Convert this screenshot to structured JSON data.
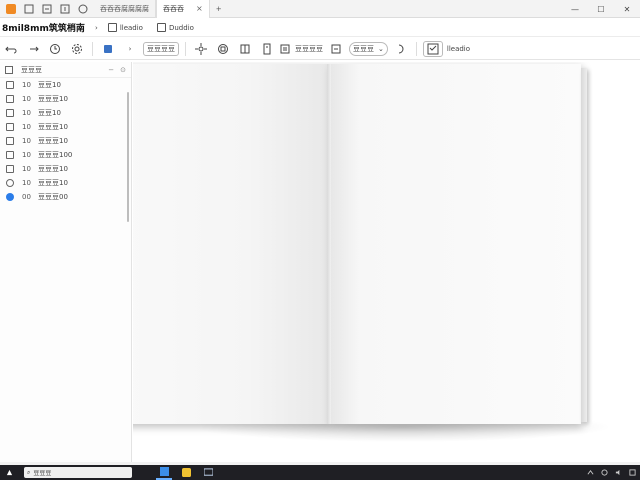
{
  "tabs": [
    {
      "label": "吞吞吞腐腐腐腐",
      "active": false
    },
    {
      "label": "吞吞吞",
      "active": true
    }
  ],
  "document": {
    "title": "8mil8mm筑筑梢南"
  },
  "menu": {
    "items": [
      {
        "label": "lleadio"
      },
      {
        "label": "Duddio"
      }
    ]
  },
  "toolbar": {
    "style_box": "豆豆豆豆",
    "value_box": "豆豆豆",
    "view_label": "lleadio"
  },
  "sidebar": {
    "title": "豆豆豆",
    "items": [
      {
        "num": "10",
        "label": "豆豆10",
        "icon": "pen-icon"
      },
      {
        "num": "10",
        "label": "豆豆豆10",
        "icon": "lock-icon"
      },
      {
        "num": "10",
        "label": "豆豆10",
        "icon": "list-icon"
      },
      {
        "num": "10",
        "label": "豆豆豆10",
        "icon": "grid-icon"
      },
      {
        "num": "10",
        "label": "豆豆豆10",
        "icon": "home-icon"
      },
      {
        "num": "10",
        "label": "豆豆豆100",
        "icon": "doc-icon"
      },
      {
        "num": "10",
        "label": "豆豆豆10",
        "icon": "bag-icon"
      },
      {
        "num": "10",
        "label": "豆豆豆10",
        "icon": "clock-icon"
      },
      {
        "num": "00",
        "label": "豆豆豆00",
        "icon": "globe-icon"
      }
    ]
  },
  "taskbar": {
    "search_placeholder": "豆豆豆"
  },
  "colors": {
    "accent": "#2b7de9",
    "taskbar": "#1f1f24",
    "tab_bar": "#f3f3f3"
  }
}
